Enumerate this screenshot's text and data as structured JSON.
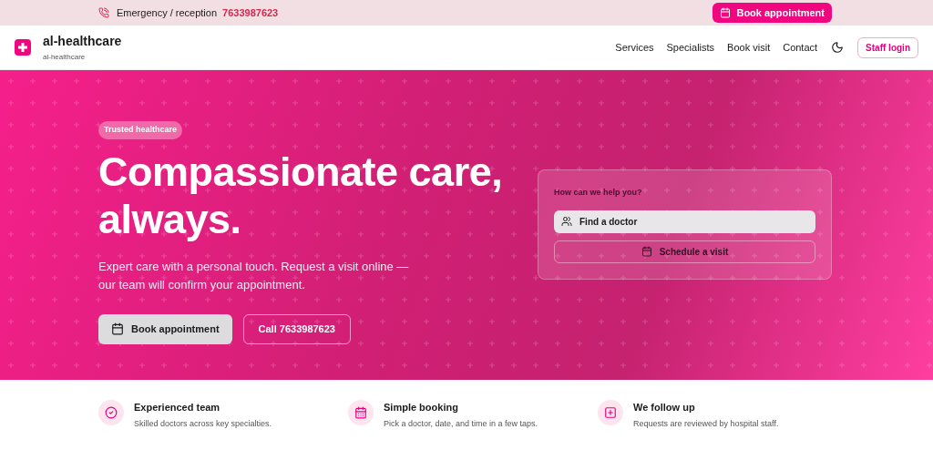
{
  "topbar": {
    "emergency_label": "Emergency / reception",
    "emergency_phone": "7633987623",
    "book_button": "Book appointment"
  },
  "header": {
    "brand": "al-healthcare",
    "brand_sub": "al-healthcare",
    "nav": [
      "Services",
      "Specialists",
      "Book visit",
      "Contact"
    ],
    "dark_mode_toggle": {
      "on": false
    },
    "staff_login": "Staff login"
  },
  "hero": {
    "badge": "Trusted healthcare",
    "title_lines": [
      "Compassionate care,",
      "always."
    ],
    "description": "Expert care with a personal touch. Request a visit online — our team will confirm your appointment.",
    "buttons": [
      {
        "label": "Book appointment",
        "kind": "primary"
      },
      {
        "label": "Call 7633987623",
        "kind": "outline"
      }
    ],
    "help_card": {
      "title": "How can we help you?",
      "actions": [
        {
          "label": "Find a doctor",
          "kind": "primary"
        },
        {
          "label": "Schedule a visit",
          "kind": "outline"
        }
      ]
    }
  },
  "features": [
    {
      "kind": "check",
      "title": "Experienced team",
      "text": "Skilled doctors across key specialties."
    },
    {
      "kind": "calendar",
      "title": "Simple booking",
      "text": "Pick a doctor, date, and time in a few taps."
    },
    {
      "kind": "plus",
      "title": "We follow up",
      "text": "Requests are reviewed by hospital staff."
    }
  ]
}
